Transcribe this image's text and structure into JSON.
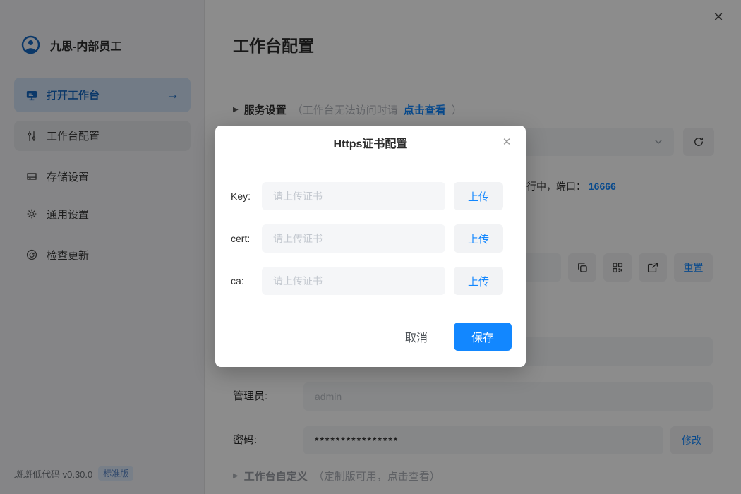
{
  "icons": {
    "close": "✕",
    "caret_right": "▶",
    "arrow_right": "→"
  },
  "colors": {
    "accent_blue": "#1287ff",
    "sidebar_active_blue": "#1566c0",
    "sidebar_active_bg": "#cfe0f4",
    "badge_bg": "#dbe7f7",
    "badge_text": "#5b87c7",
    "mask": "rgba(0,0,0,0.45)"
  },
  "sidebar": {
    "user_name": "九思-内部员工",
    "items": [
      {
        "label": "打开工作台"
      },
      {
        "label": "工作台配置"
      },
      {
        "label": "存储设置"
      },
      {
        "label": "通用设置"
      },
      {
        "label": "检查更新"
      }
    ],
    "footer": {
      "version": "斑斑低代码 v0.30.0",
      "edition": "标准版"
    }
  },
  "main": {
    "page_title": "工作台配置",
    "service_section": {
      "label": "服务设置",
      "hint_prefix": "（工作台无法访问时请",
      "hint_link": "点击查看",
      "hint_suffix": "）"
    },
    "status": {
      "visible_text": "行中，端口：",
      "port": "16666"
    },
    "reset_button": "重置",
    "admin_field": {
      "label": "管理员:",
      "value": "admin"
    },
    "password_field": {
      "label": "密码:",
      "value": "****************",
      "modify_button": "修改"
    },
    "customize_section": {
      "label": "工作台自定义",
      "hint": "（定制版可用，点击查看）"
    }
  },
  "modal": {
    "title": "Https证书配置",
    "rows": [
      {
        "label": "Key:",
        "placeholder": "请上传证书",
        "upload": "上传"
      },
      {
        "label": "cert:",
        "placeholder": "请上传证书",
        "upload": "上传"
      },
      {
        "label": "ca:",
        "placeholder": "请上传证书",
        "upload": "上传"
      }
    ],
    "cancel_button": "取消",
    "save_button": "保存"
  }
}
